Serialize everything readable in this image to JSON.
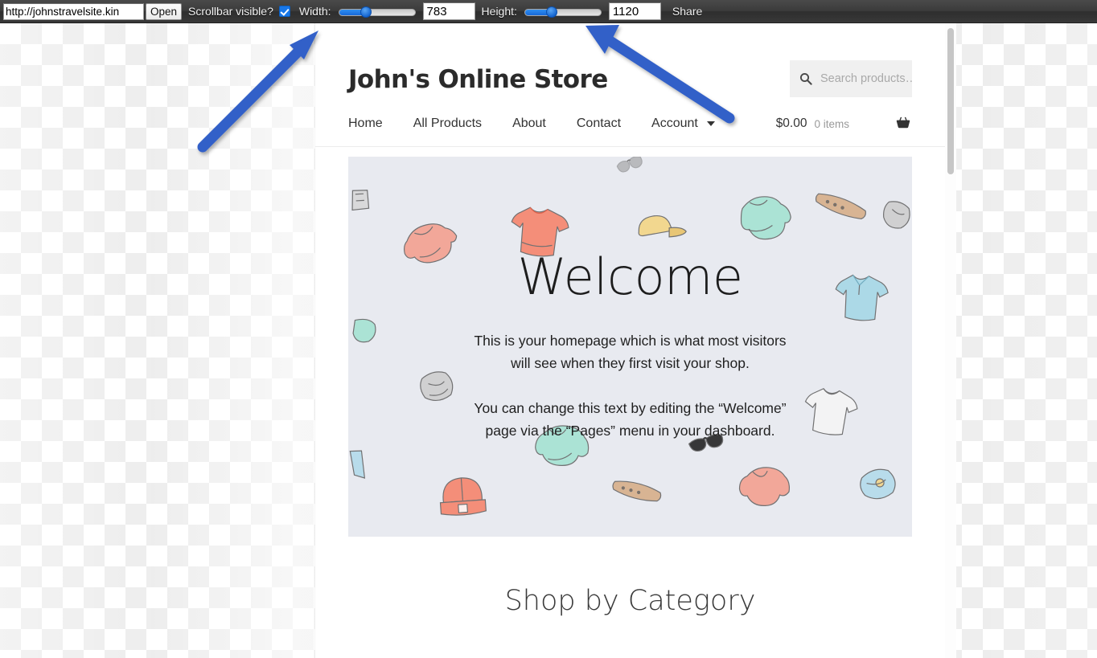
{
  "toolbar": {
    "url_value": "http://johnstravelsite.kin",
    "url_placeholder": "http://",
    "open_label": "Open",
    "scrollbar_label": "Scrollbar visible?",
    "scrollbar_checked": true,
    "width_label": "Width:",
    "width_value": "783",
    "width_slider_percent": 33,
    "height_label": "Height:",
    "height_value": "1120",
    "height_slider_percent": 33,
    "share_label": "Share"
  },
  "site": {
    "title": "John's Online Store",
    "search": {
      "placeholder": "Search products…",
      "value": "",
      "icon": "search-icon"
    },
    "nav": [
      {
        "label": "Home",
        "name": "nav-home"
      },
      {
        "label": "All Products",
        "name": "nav-all-products"
      },
      {
        "label": "About",
        "name": "nav-about"
      },
      {
        "label": "Contact",
        "name": "nav-contact"
      },
      {
        "label": "Account",
        "name": "nav-account",
        "has_dropdown": true
      }
    ],
    "cart": {
      "total": "$0.00",
      "items": "0 items",
      "icon": "shopping-basket-icon"
    },
    "hero": {
      "title": "Welcome",
      "paragraph1": "This is your homepage which is what most visitors will see when they first visit your shop.",
      "paragraph2": "You can change this text by editing the “Welcome” page via the “Pages” menu in your dashboard.",
      "background_color": "#e8eaf0",
      "illustration": "scattered-clothing-sketches"
    },
    "category_section": {
      "title": "Shop by Category"
    }
  },
  "annotations": {
    "arrow_color": "#3360c8",
    "arrow_1_target": "width-controls",
    "arrow_2_target": "height-controls"
  },
  "colors": {
    "toolbar_bg": "#3b3b3b",
    "accent_blue": "#1877e8",
    "hero_bg": "#e8eaf0",
    "text_dark": "#2b2b2b"
  }
}
